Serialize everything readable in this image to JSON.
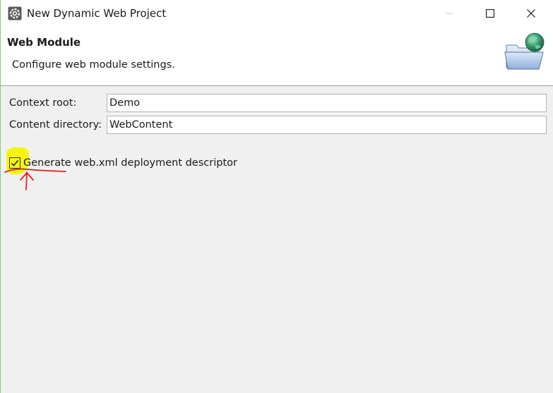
{
  "window": {
    "title": "New Dynamic Web Project",
    "app_icon": "eclipse-gear-icon",
    "controls": [
      "minimize-icon",
      "maximize-icon",
      "close-icon"
    ]
  },
  "banner": {
    "title": "Web Module",
    "description": "Configure web module settings.",
    "icon": "web-folder-globe-icon"
  },
  "form": {
    "context_root": {
      "label": "Context root:",
      "value": "Demo"
    },
    "content_directory": {
      "label": "Content directory:",
      "value": "WebContent"
    },
    "generate_descriptor": {
      "label": "Generate web.xml deployment descriptor",
      "checked": true
    }
  },
  "annotation": {
    "highlight_color": "#f5f500",
    "mark_color": "#e02020"
  }
}
